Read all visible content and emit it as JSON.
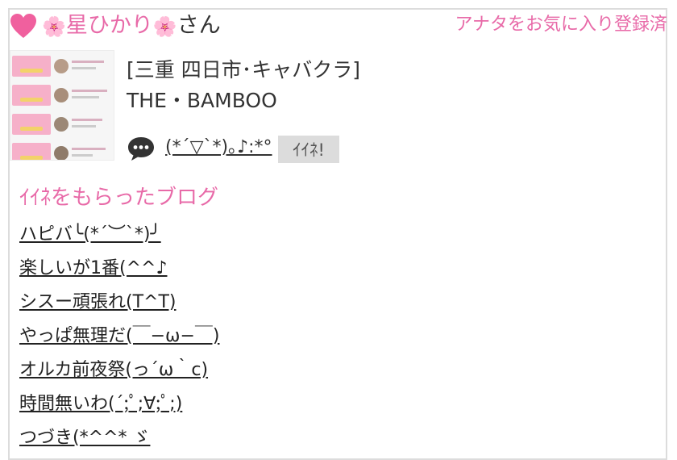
{
  "profile": {
    "flower_left": "🌸",
    "name": "星ひかり",
    "flower_right": "🌸",
    "honorific": "さん",
    "favorite_label": "アナタをお気に入り登録済",
    "heart_color": "#f0609e",
    "accent_color": "#e86aa8"
  },
  "shop": {
    "area": "[三重 四日市･キャバクラ]",
    "name": "THE・BAMBOO"
  },
  "comment": {
    "icon": "speech-bubble-icon",
    "text": "(*´▽`*)｡♪:*°",
    "like_button": "ｲｲﾈ!"
  },
  "blog": {
    "title": "ｲｲﾈをもらったブログ",
    "posts": [
      "ハピバ╰(*´︶`*)╯",
      "楽しいが1番(^^♪",
      "シスー頑張れ(T^T)",
      "やっぱ無理だ(￣−ω−￣)",
      "オルカ前夜祭(っ´ω｀c)",
      "時間無いわ(´;ﾟ;∀;ﾟ;)",
      "つづき(*^^* ゞ"
    ]
  }
}
